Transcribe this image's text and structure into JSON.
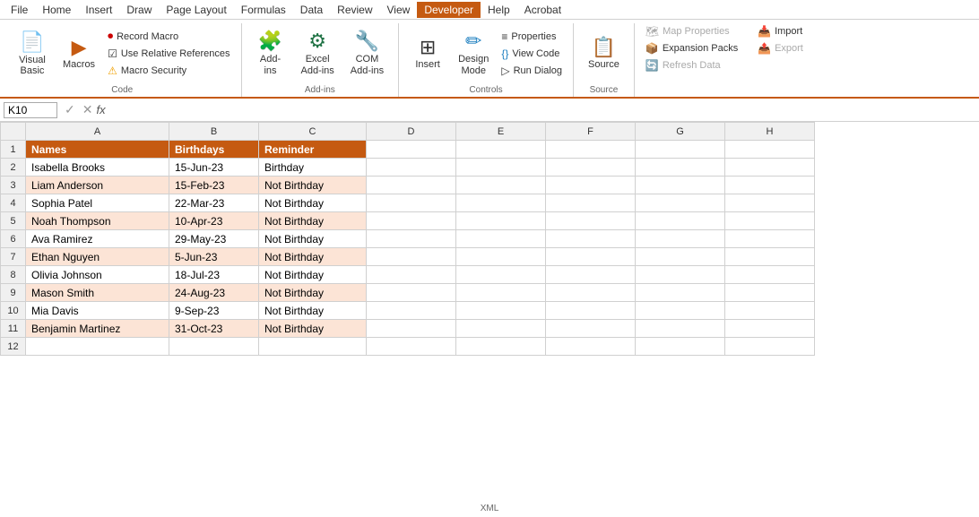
{
  "menu": {
    "items": [
      "File",
      "Home",
      "Insert",
      "Draw",
      "Page Layout",
      "Formulas",
      "Data",
      "Review",
      "View",
      "Developer",
      "Help",
      "Acrobat"
    ],
    "active": "Developer"
  },
  "ribbon": {
    "active_tab": "Developer",
    "groups": [
      {
        "name": "Code",
        "buttons_large": [
          {
            "id": "visual-basic",
            "icon": "📄",
            "label": "Visual\nBasic"
          },
          {
            "id": "macros",
            "icon": "▶",
            "label": "Macros"
          }
        ],
        "buttons_small": [
          {
            "id": "record-macro",
            "icon": "⏺",
            "label": "Record Macro",
            "is_rec": true
          },
          {
            "id": "use-relative",
            "icon": "☑",
            "label": "Use Relative References"
          },
          {
            "id": "macro-security",
            "icon": "⚠",
            "label": "Macro Security",
            "is_warn": true
          }
        ]
      },
      {
        "name": "Add-ins",
        "buttons_large": [
          {
            "id": "add-ins",
            "icon": "🧩",
            "label": "Add-\nins"
          },
          {
            "id": "excel-add-ins",
            "icon": "⚙",
            "label": "Excel\nAdd-ins"
          },
          {
            "id": "com-add-ins",
            "icon": "🔧",
            "label": "COM\nAdd-ins"
          }
        ]
      },
      {
        "name": "Controls",
        "buttons_large": [
          {
            "id": "insert",
            "icon": "⊞",
            "label": "Insert"
          },
          {
            "id": "design-mode",
            "icon": "✏",
            "label": "Design\nMode"
          }
        ],
        "buttons_small": [
          {
            "id": "properties",
            "icon": "≡",
            "label": "Properties"
          },
          {
            "id": "view-code",
            "icon": "{ }",
            "label": "View Code"
          },
          {
            "id": "run-dialog",
            "icon": "▷",
            "label": "Run Dialog"
          }
        ]
      },
      {
        "name": "Source",
        "buttons_large": [
          {
            "id": "source",
            "icon": "📋",
            "label": "Source"
          }
        ]
      },
      {
        "name": "XML",
        "buttons_small": [
          {
            "id": "map-properties",
            "icon": "🗺",
            "label": "Map Properties",
            "disabled": true
          },
          {
            "id": "expansion-packs",
            "icon": "📦",
            "label": "Expansion Packs"
          },
          {
            "id": "refresh-data",
            "icon": "🔄",
            "label": "Refresh Data",
            "disabled": true
          },
          {
            "id": "import",
            "icon": "📥",
            "label": "Import"
          },
          {
            "id": "export",
            "icon": "📤",
            "label": "Export",
            "disabled": true
          }
        ]
      }
    ]
  },
  "formula_bar": {
    "cell_ref": "K10",
    "formula": ""
  },
  "columns": [
    "A",
    "B",
    "C",
    "D",
    "E",
    "F",
    "G",
    "H"
  ],
  "header_row": {
    "cells": [
      "Names",
      "Birthdays",
      "Reminder"
    ]
  },
  "rows": [
    {
      "num": 2,
      "cells": [
        "Isabella Brooks",
        "15-Jun-23",
        "Birthday"
      ],
      "alt": false
    },
    {
      "num": 3,
      "cells": [
        "Liam Anderson",
        "15-Feb-23",
        "Not Birthday"
      ],
      "alt": true
    },
    {
      "num": 4,
      "cells": [
        "Sophia Patel",
        "22-Mar-23",
        "Not Birthday"
      ],
      "alt": false
    },
    {
      "num": 5,
      "cells": [
        "Noah Thompson",
        "10-Apr-23",
        "Not Birthday"
      ],
      "alt": true
    },
    {
      "num": 6,
      "cells": [
        "Ava Ramirez",
        "29-May-23",
        "Not Birthday"
      ],
      "alt": false
    },
    {
      "num": 7,
      "cells": [
        "Ethan Nguyen",
        "5-Jun-23",
        "Not Birthday"
      ],
      "alt": true
    },
    {
      "num": 8,
      "cells": [
        "Olivia Johnson",
        "18-Jul-23",
        "Not Birthday"
      ],
      "alt": false
    },
    {
      "num": 9,
      "cells": [
        "Mason Smith",
        "24-Aug-23",
        "Not Birthday"
      ],
      "alt": true
    },
    {
      "num": 10,
      "cells": [
        "Mia Davis",
        "9-Sep-23",
        "Not Birthday"
      ],
      "alt": false
    },
    {
      "num": 11,
      "cells": [
        "Benjamin Martinez",
        "31-Oct-23",
        "Not Birthday"
      ],
      "alt": true
    },
    {
      "num": 12,
      "cells": [
        "",
        "",
        ""
      ],
      "alt": false
    }
  ],
  "colors": {
    "accent": "#c55a11",
    "alt_row": "#fce4d6",
    "header_bg": "#c55a11",
    "header_text": "#ffffff"
  }
}
